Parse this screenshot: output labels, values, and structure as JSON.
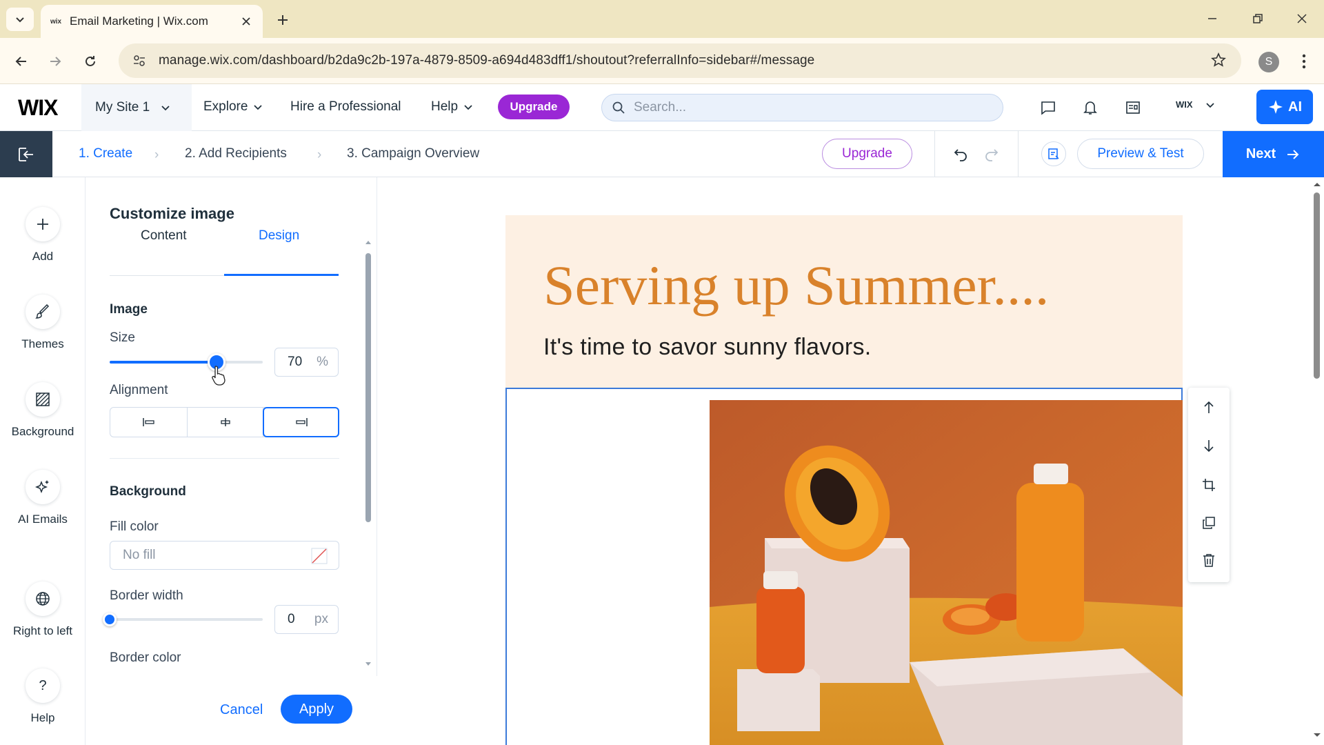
{
  "browser": {
    "tab_title": "Email Marketing | Wix.com",
    "tab_favicon": "wix",
    "url": "manage.wix.com/dashboard/b2da9c2b-197a-4879-8509-a694d483dff1/shoutout?referralInfo=sidebar#/message",
    "profile_initial": "S"
  },
  "wix_topbar": {
    "logo": "WIX",
    "site_name": "My Site 1",
    "nav": {
      "explore": "Explore",
      "hire": "Hire a Professional",
      "help": "Help"
    },
    "upgrade": "Upgrade",
    "search_placeholder": "Search...",
    "account_logo": "WIX",
    "ai_label": "AI"
  },
  "stepbar": {
    "steps": [
      "1. Create",
      "2. Add Recipients",
      "3. Campaign Overview"
    ],
    "upgrade": "Upgrade",
    "preview": "Preview & Test",
    "next": "Next"
  },
  "left_rail": {
    "items": [
      {
        "label": "Add",
        "icon": "plus-icon"
      },
      {
        "label": "Themes",
        "icon": "brush-icon"
      },
      {
        "label": "Background",
        "icon": "background-pattern-icon"
      },
      {
        "label": "AI Emails",
        "icon": "sparkle-icon"
      },
      {
        "label": "Right to left",
        "icon": "globe-icon"
      },
      {
        "label": "Help",
        "icon": "question-icon"
      }
    ]
  },
  "panel": {
    "title": "Customize image",
    "tabs": [
      "Content",
      "Design"
    ],
    "active_tab": "Design",
    "image_section": "Image",
    "size_label": "Size",
    "size_value": "70",
    "size_unit": "%",
    "size_level": 0.7,
    "alignment_label": "Alignment",
    "alignment_options": [
      "left",
      "center",
      "right"
    ],
    "alignment_selected": "right",
    "background_section": "Background",
    "fill_label": "Fill color",
    "fill_value": "No fill",
    "border_width_label": "Border width",
    "border_width_value": "0",
    "border_width_unit": "px",
    "border_width_level": 0,
    "border_color_label": "Border color",
    "cancel": "Cancel",
    "apply": "Apply"
  },
  "email": {
    "headline": "Serving up Summer....",
    "subline": "It's time to savor sunny flavors.",
    "headline_color": "#d9822b",
    "header_bg": "#fdf0e3"
  },
  "colors": {
    "accent": "#116dff",
    "upgrade": "#9a27d5",
    "exit_bg": "#2c3d4f"
  }
}
